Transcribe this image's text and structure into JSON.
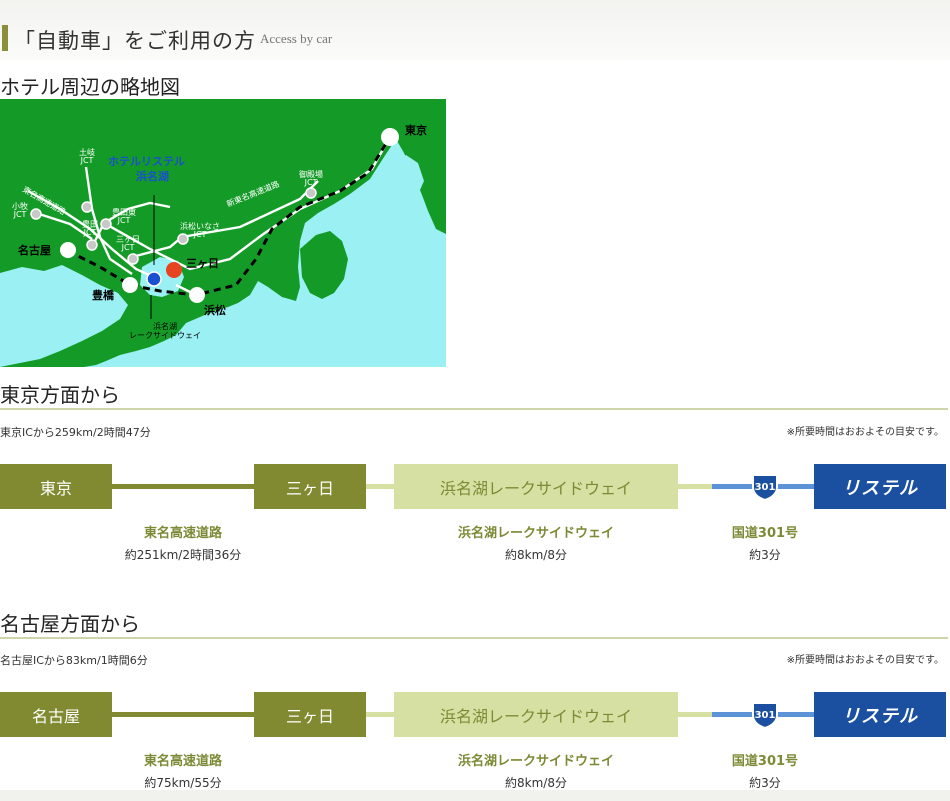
{
  "header": {
    "title": "「自動車」をご利用の方",
    "subtitle": "Access by car"
  },
  "map_section": {
    "title": "ホテル周辺の略地図",
    "labels": {
      "tokyo": "東京",
      "nagoya": "名古屋",
      "toyohashi": "豊橋",
      "hamamatsu": "浜松",
      "mikkabi": "三ヶ日",
      "hotel_line1": "ホテルリステル",
      "hotel_line2": "浜名湖",
      "toki_jct_1": "土岐",
      "toki_jct_2": "JCT",
      "komaki_jct_1": "小牧",
      "komaki_jct_2": "JCT",
      "toyota_jct_1": "豊田",
      "toyota_jct_2": "JCT",
      "toyotahigashi_jct_1": "豊田東",
      "toyotahigashi_jct_2": "JCT",
      "mikkabi_jct_1": "三ヶ日",
      "mikkabi_jct_2": "JCT",
      "hamamatsuinasa_jct_1": "浜松いなさ",
      "hamamatsuinasa_jct_2": "JCT",
      "gotemba_jct_1": "御殿場",
      "gotemba_jct_2": "JCT",
      "tomei": "東名高速道路",
      "shintomei": "新東名高速道路",
      "lakeside_1": "浜名湖",
      "lakeside_2": "レークサイドウェイ"
    }
  },
  "routes": [
    {
      "title": "東京方面から",
      "from_text": "東京ICから259km/2時間47分",
      "note": "※所要時間はおおよその目安です。",
      "start": "東京",
      "mid": "三ヶ日",
      "lakeside": "浜名湖レークサイドウェイ",
      "shield": "301",
      "dest": "リステル",
      "seg1_name": "東名高速道路",
      "seg1_detail": "約251km/2時間36分",
      "seg2_name": "浜名湖レークサイドウェイ",
      "seg2_detail": "約8km/8分",
      "seg3_name": "国道301号",
      "seg3_detail": "約3分"
    },
    {
      "title": "名古屋方面から",
      "from_text": "名古屋ICから83km/1時間6分",
      "note": "※所要時間はおおよその目安です。",
      "start": "名古屋",
      "mid": "三ヶ日",
      "lakeside": "浜名湖レークサイドウェイ",
      "shield": "301",
      "dest": "リステル",
      "seg1_name": "東名高速道路",
      "seg1_detail": "約75km/55分",
      "seg2_name": "浜名湖レークサイドウェイ",
      "seg2_detail": "約8km/8分",
      "seg3_name": "国道301号",
      "seg3_detail": "約3分"
    }
  ],
  "colors": {
    "olive": "#818a30",
    "pale_green": "#d6e0a2",
    "blue": "#1b4fa0",
    "sea": "#9af0f3",
    "land": "#149b27"
  }
}
